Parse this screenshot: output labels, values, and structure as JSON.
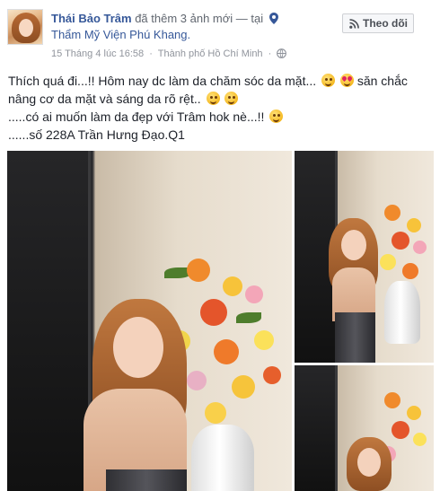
{
  "post": {
    "author": "Thái Bảo Trâm",
    "action_text": "đã thêm 3 ảnh mới — tại",
    "location": "Thẩm Mỹ Viện Phú Khang.",
    "timestamp": "15 Tháng 4 lúc 16:58",
    "separator": "·",
    "place_city": "Thành phố Hồ Chí Minh",
    "separator2": "·",
    "follow_label": "Theo dõi",
    "text_lines": [
      "Thích quá đi...!! Hôm nay dc làm da chăm sóc da mặt...",
      "săn chắc",
      "nâng cơ da mặt và sáng da rõ rệt..",
      ".....có ai muốn làm da đẹp với Trâm hok nè...!!",
      "......số 228A Trần Hưng Đạo.Q1"
    ],
    "photo_count": 3
  },
  "icons": {
    "location": "map-pin-icon",
    "privacy": "globe-icon",
    "follow": "rss-icon"
  },
  "colors": {
    "link": "#365899",
    "muted": "#90949c",
    "text": "#1d2129"
  }
}
